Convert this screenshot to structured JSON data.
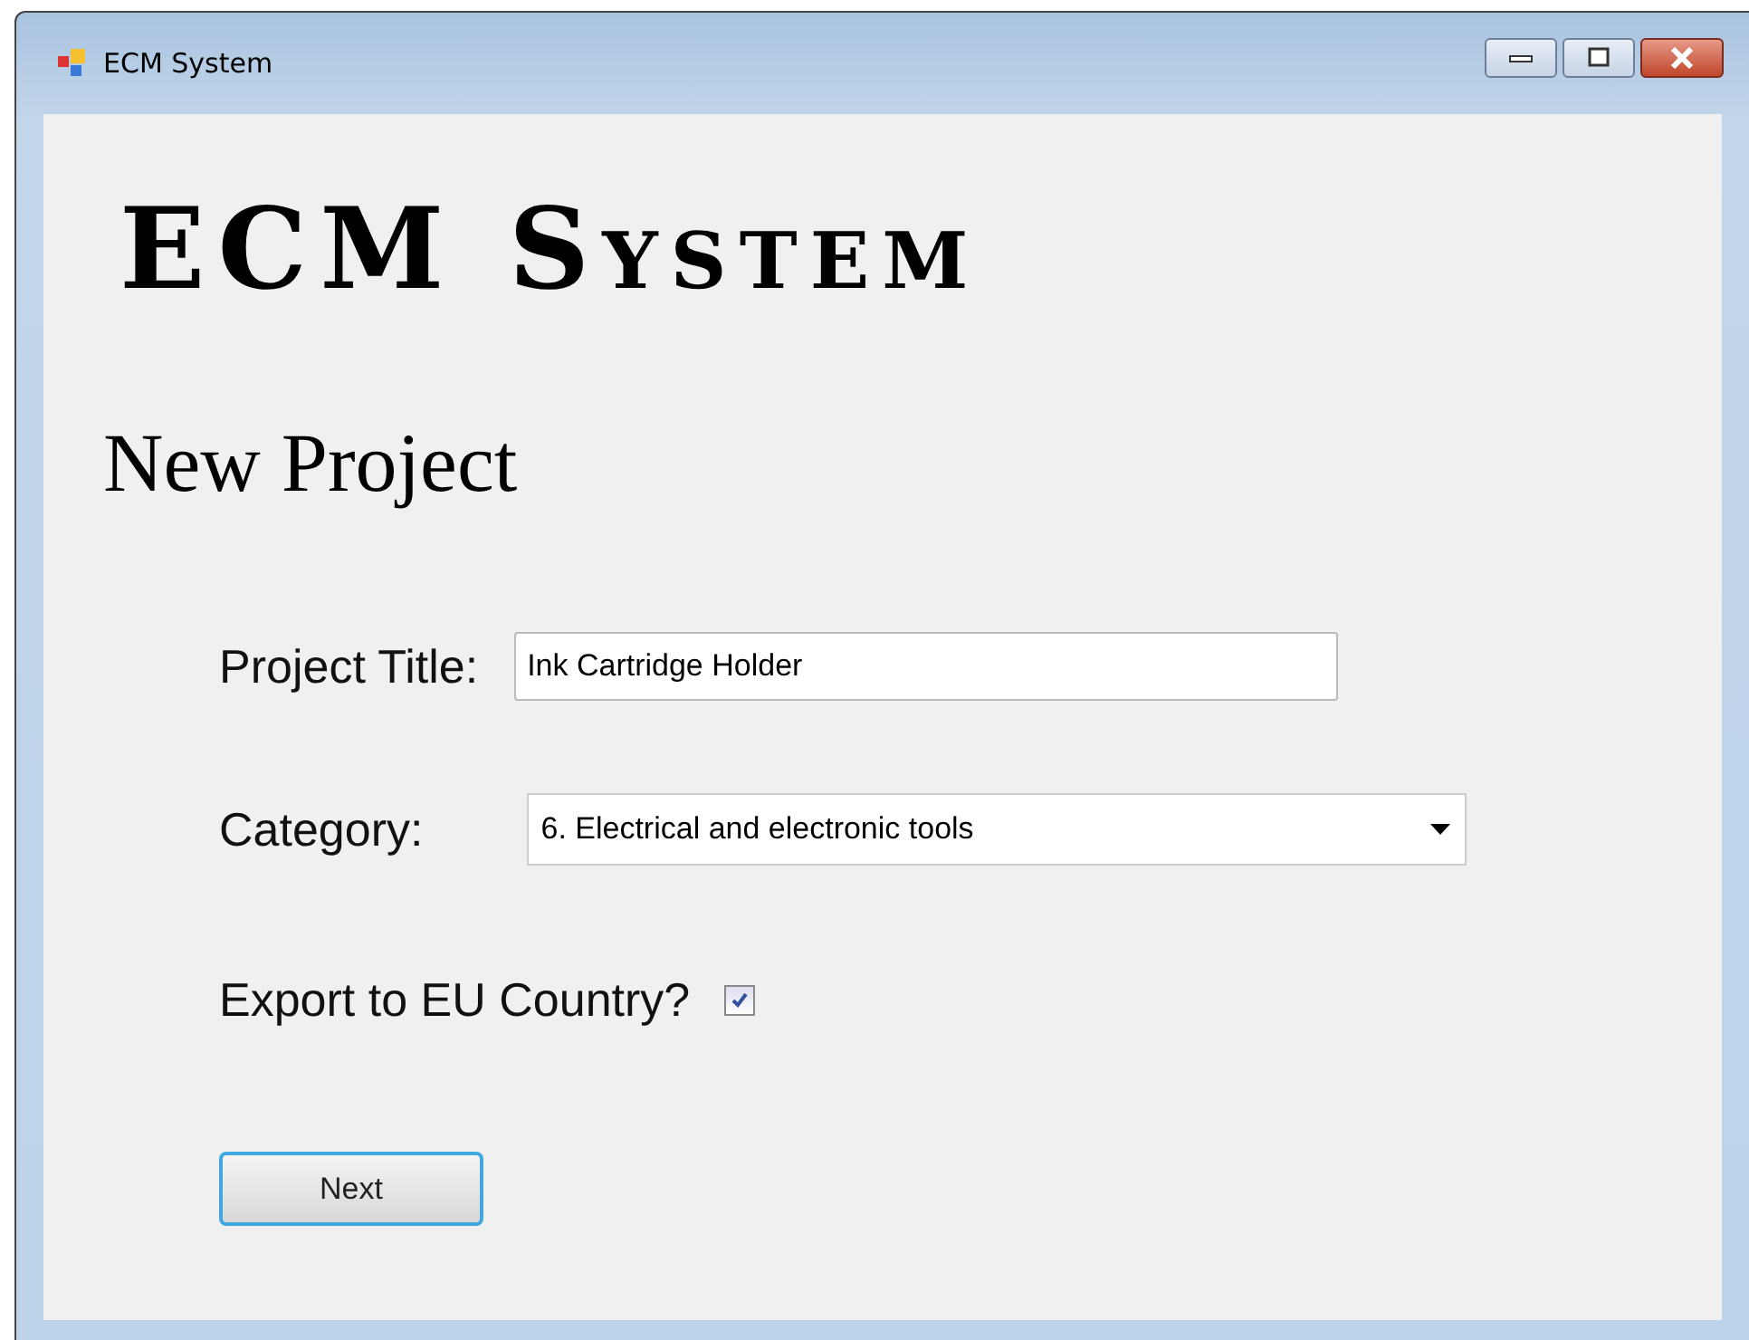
{
  "window": {
    "title": "ECM System"
  },
  "heading": "ECM System",
  "subheading": "New Project",
  "form": {
    "project_title": {
      "label": "Project Title:",
      "value": "Ink Cartridge Holder"
    },
    "category": {
      "label": "Category:",
      "value": "6. Electrical and electronic tools"
    },
    "export": {
      "label": "Export to EU Country?",
      "checked": true
    }
  },
  "buttons": [
    "Next"
  ]
}
